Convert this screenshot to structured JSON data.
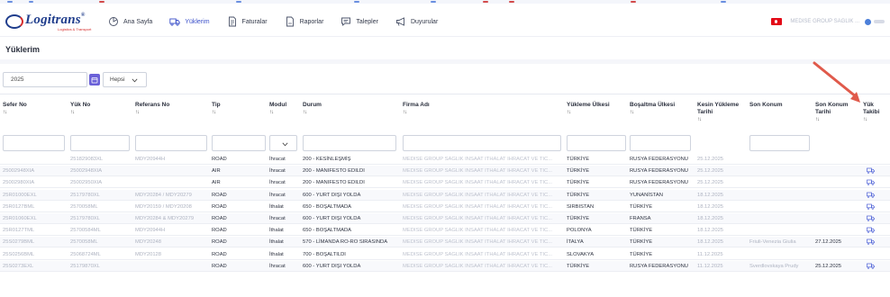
{
  "nav": {
    "brand": "Logitrans",
    "brand_tagline": "Logistics & Transport",
    "items": [
      {
        "label": "Ana Sayfa",
        "icon": "home-icon",
        "active": false
      },
      {
        "label": "Yüklerim",
        "icon": "truck-icon",
        "active": true
      },
      {
        "label": "Faturalar",
        "icon": "invoice-icon",
        "active": false
      },
      {
        "label": "Raporlar",
        "icon": "report-icon",
        "active": false
      },
      {
        "label": "Talepler",
        "icon": "chat-icon",
        "active": false
      },
      {
        "label": "Duyurular",
        "icon": "megaphone-icon",
        "active": false
      }
    ],
    "user_name": "MEDISE GROUP SAGLIK ...",
    "accent": "#3a4fc9"
  },
  "page": {
    "title": "Yüklerim"
  },
  "filters": {
    "year": "2025",
    "scope": "Hepsi"
  },
  "table": {
    "sort_glyph": "↑↓",
    "columns": [
      {
        "label": "Sefer No"
      },
      {
        "label": "Yük No"
      },
      {
        "label": "Referans No"
      },
      {
        "label": "Tip"
      },
      {
        "label": "Modul"
      },
      {
        "label": "Durum"
      },
      {
        "label": "Firma Adı"
      },
      {
        "label": "Yükleme Ülkesi"
      },
      {
        "label": "Boşaltma Ülkesi"
      },
      {
        "label": "Kesin Yükleme Tarihi"
      },
      {
        "label": "Son Konum"
      },
      {
        "label": "Son Konum Tarihi"
      },
      {
        "label": "Yük Takibi"
      }
    ],
    "rows": [
      {
        "sefer": "",
        "yuk": "251829083XL",
        "ref": "MDY20944H",
        "tip": "ROAD",
        "modul": "İhracat",
        "durum": "200 - KESİNLEŞMİŞ",
        "firma": "MEDISE GROUP SAGLIK INSAAT ITHALAT IHRACAT VE TIC...",
        "yukleme": "TÜRKİYE",
        "bosaltma": "RUSYA FEDERASYONU",
        "tarih": "25.12.2025",
        "konum": "",
        "konum_tarihi": "",
        "takip": false
      },
      {
        "sefer": "25002948XIA",
        "yuk": "25002948XIA",
        "ref": "",
        "tip": "AIR",
        "modul": "İhracat",
        "durum": "200 - MANIFESTO EDILDI",
        "firma": "MEDISE GROUP SAGLIK INSAAT ITHALAT IHRACAT VE TIC...",
        "yukleme": "TÜRKİYE",
        "bosaltma": "RUSYA FEDERASYONU",
        "tarih": "25.12.2025",
        "konum": "",
        "konum_tarihi": "",
        "takip": true
      },
      {
        "sefer": "25002980XIA",
        "yuk": "25002950XIA",
        "ref": "",
        "tip": "AIR",
        "modul": "İhracat",
        "durum": "200 - MANIFESTO EDILDI",
        "firma": "MEDISE GROUP SAGLIK INSAAT ITHALAT IHRACAT VE TIC...",
        "yukleme": "TÜRKİYE",
        "bosaltma": "RUSYA FEDERASYONU",
        "tarih": "25.12.2025",
        "konum": "",
        "konum_tarihi": "",
        "takip": true
      },
      {
        "sefer": "25R01000EXL",
        "yuk": "25179780XL",
        "ref": "MDY20284 / MDY20279",
        "tip": "ROAD",
        "modul": "İhracat",
        "durum": "600 - YURT DIŞI YOLDA",
        "firma": "MEDISE GROUP SAGLIK INSAAT ITHALAT IHRACAT VE TIC...",
        "yukleme": "TÜRKİYE",
        "bosaltma": "YUNANİSTAN",
        "tarih": "18.12.2025",
        "konum": "",
        "konum_tarihi": "",
        "takip": true
      },
      {
        "sefer": "25R0127BML",
        "yuk": "2570058ML",
        "ref": "MDY20159 / MDY20208",
        "tip": "ROAD",
        "modul": "İthalat",
        "durum": "650 - BOŞALTMADA",
        "firma": "MEDISE GROUP SAGLIK INSAAT ITHALAT IHRACAT VE TIC...",
        "yukleme": "SIRBISTAN",
        "bosaltma": "TÜRKİYE",
        "tarih": "18.12.2025",
        "konum": "",
        "konum_tarihi": "",
        "takip": true
      },
      {
        "sefer": "25R01060EXL",
        "yuk": "25179780XL",
        "ref": "MDY20284 & MDY20279",
        "tip": "ROAD",
        "modul": "İhracat",
        "durum": "600 - YURT DIŞI YOLDA",
        "firma": "MEDISE GROUP SAGLIK INSAAT ITHALAT IHRACAT VE TIC...",
        "yukleme": "TÜRKİYE",
        "bosaltma": "FRANSA",
        "tarih": "18.12.2025",
        "konum": "",
        "konum_tarihi": "",
        "takip": true
      },
      {
        "sefer": "25R0127TML",
        "yuk": "25700584ML",
        "ref": "MDY20944H",
        "tip": "ROAD",
        "modul": "İthalat",
        "durum": "650 - BOŞALTMADA",
        "firma": "MEDISE GROUP SAGLIK INSAAT ITHALAT IHRACAT VE TIC...",
        "yukleme": "POLONYA",
        "bosaltma": "TÜRKİYE",
        "tarih": "18.12.2025",
        "konum": "",
        "konum_tarihi": "",
        "takip": true
      },
      {
        "sefer": "25S0279BML",
        "yuk": "2570058ML",
        "ref": "MDY20248",
        "tip": "ROAD",
        "modul": "İthalat",
        "durum": "570 - LİMANDA RO-RO SIRASINDA",
        "firma": "MEDISE GROUP SAGLIK INSAAT ITHALAT IHRACAT VE TIC...",
        "yukleme": "İTALYA",
        "bosaltma": "TÜRKİYE",
        "tarih": "18.12.2025",
        "konum": "Friuli-Venezia Giulia",
        "konum_tarihi": "27.12.2025",
        "takip": true
      },
      {
        "sefer": "25S0256BML",
        "yuk": "25068724ML",
        "ref": "MDY20128",
        "tip": "ROAD",
        "modul": "İthalat",
        "durum": "700 - BOŞALTILDI",
        "firma": "MEDISE GROUP SAGLIK INSAAT ITHALAT IHRACAT VE TIC...",
        "yukleme": "SLOVAKYA",
        "bosaltma": "TÜRKİYE",
        "tarih": "11.12.2025",
        "konum": "",
        "konum_tarihi": "",
        "takip": false
      },
      {
        "sefer": "25S0273EXL",
        "yuk": "25179870XL",
        "ref": "",
        "tip": "ROAD",
        "modul": "İhracat",
        "durum": "600 - YURT DIŞI YOLDA",
        "firma": "MEDISE GROUP SAGLIK INSAAT ITHALAT IHRACAT VE TIC...",
        "yukleme": "TÜRKİYE",
        "bosaltma": "RUSYA FEDERASYONU",
        "tarih": "11.12.2025",
        "konum": "Sverdlovskaya Prudy",
        "konum_tarihi": "25.12.2025",
        "takip": true
      }
    ]
  },
  "colors": {
    "arrow": "#e05a4b",
    "calendar_button": "#6b61d8",
    "truck_icon": "#4b5fd6"
  }
}
